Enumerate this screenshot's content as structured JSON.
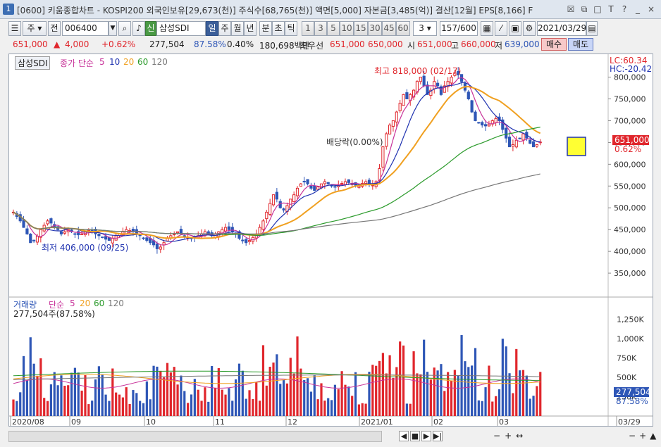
{
  "window": {
    "badge": "1",
    "title": "[0600] 키움종합차트 - KOSPI200 외국인보유[29,673(천)] 주식수[68,765(천)] 액면[5,000] 자본금[3,485(억)] 결산[12월] EPS[8,166] F",
    "buttons": [
      "☒",
      "⧉",
      "□",
      "T",
      "?",
      "_",
      "×"
    ]
  },
  "toolbar": {
    "period_label": "주",
    "before_label": "전",
    "code": "006400",
    "new_label": "신",
    "stock_name": "삼성SDI",
    "intervals": [
      "일",
      "주",
      "월",
      "년",
      "분",
      "초",
      "틱"
    ],
    "numbers": [
      "1",
      "3",
      "5",
      "10",
      "15",
      "30",
      "45",
      "60"
    ],
    "step": "3",
    "count": "157/600",
    "date": "2021/03/29"
  },
  "quote": {
    "price": "651,000",
    "change": "4,000",
    "change_pct": "+0.62%",
    "volume": "277,504",
    "vol_ratio": "87.58%",
    "turnover": "0.40%",
    "amount": "180,698백만",
    "priority_label": "최우선",
    "ask": "651,000",
    "bid": "650,000",
    "open_label": "시",
    "open": "651,000",
    "high_label": "고",
    "high": "660,000",
    "low_label": "저",
    "low": "639,000",
    "buy": "매수",
    "sell": "매도"
  },
  "price_panel": {
    "stock_tag": "삼성SDI",
    "ma_title": "종가 단순",
    "ma_periods": [
      "5",
      "10",
      "20",
      "60",
      "120"
    ],
    "lc": "LC:60.34",
    "hc": "HC:-20.42",
    "high_mark": "최고 818,000 (02/17)",
    "low_mark": "최저 406,000 (09/25)",
    "div_mark": "배당락(0.00%)",
    "current_price": "651,000",
    "current_pct": "0.62%",
    "yticks": [
      "800,000",
      "750,000",
      "700,000",
      "650,000",
      "600,000",
      "550,000",
      "500,000",
      "450,000",
      "400,000",
      "350,000"
    ]
  },
  "volume_panel": {
    "title": "거래량",
    "ma_title": "단순",
    "ma_periods": [
      "5",
      "20",
      "60",
      "120"
    ],
    "current": "277,504주(87.58%)",
    "yticks": [
      "1,250K",
      "1,000K",
      "750K",
      "500K",
      "250K"
    ],
    "current_tag": "277,504",
    "current_pct": "87.58%"
  },
  "xaxis": [
    "2020/08",
    "09",
    "10",
    "11",
    "12",
    "2021/01",
    "02",
    "03",
    "03/29"
  ],
  "colors": {
    "up": "#e0262c",
    "down": "#2e56b6",
    "ma5": "#c8349a",
    "ma10": "#2033b0",
    "ma20": "#f0a020",
    "ma60": "#2a9a2a",
    "ma120": "#777777"
  },
  "chart_data": {
    "type": "candlestick",
    "title": "삼성SDI",
    "ylim": [
      300000,
      830000
    ],
    "x_range": [
      "2020/08",
      "2021/03/29"
    ],
    "highest": {
      "value": 818000,
      "date": "02/17"
    },
    "lowest": {
      "value": 406000,
      "date": "09/25"
    },
    "last": {
      "open": 651000,
      "high": 660000,
      "low": 639000,
      "close": 651000,
      "volume": 277504
    },
    "close": [
      490000,
      480000,
      470000,
      455000,
      440000,
      420000,
      425000,
      435000,
      450000,
      460000,
      470000,
      465000,
      455000,
      450000,
      440000,
      445000,
      450000,
      445000,
      440000,
      438000,
      440000,
      445000,
      450000,
      445000,
      440000,
      436000,
      432000,
      428000,
      425000,
      430000,
      436000,
      440000,
      445000,
      450000,
      448000,
      445000,
      440000,
      436000,
      430000,
      425000,
      420000,
      415000,
      406000,
      410000,
      420000,
      430000,
      436000,
      440000,
      445000,
      440000,
      436000,
      432000,
      430000,
      432000,
      436000,
      440000,
      445000,
      440000,
      436000,
      440000,
      445000,
      450000,
      455000,
      450000,
      445000,
      440000,
      430000,
      425000,
      420000,
      425000,
      432000,
      440000,
      455000,
      470000,
      490000,
      510000,
      530000,
      520000,
      500000,
      495000,
      505000,
      520000,
      530000,
      545000,
      555000,
      560000,
      555000,
      545000,
      540000,
      548000,
      555000,
      560000,
      555000,
      550000,
      548000,
      552000,
      556000,
      560000,
      558000,
      555000,
      552000,
      550000,
      556000,
      560000,
      556000,
      552000,
      560000,
      590000,
      640000,
      670000,
      690000,
      700000,
      720000,
      740000,
      760000,
      750000,
      760000,
      770000,
      790000,
      800000,
      780000,
      760000,
      770000,
      790000,
      780000,
      760000,
      780000,
      790000,
      800000,
      810000,
      805000,
      790000,
      770000,
      750000,
      720000,
      700000,
      695000,
      690000,
      688000,
      692000,
      700000,
      705000,
      700000,
      680000,
      660000,
      640000,
      645000,
      655000,
      660000,
      670000,
      660000,
      648000,
      640000,
      645000,
      651000
    ],
    "volume_ma_periods": [
      5,
      20,
      60,
      120
    ]
  }
}
